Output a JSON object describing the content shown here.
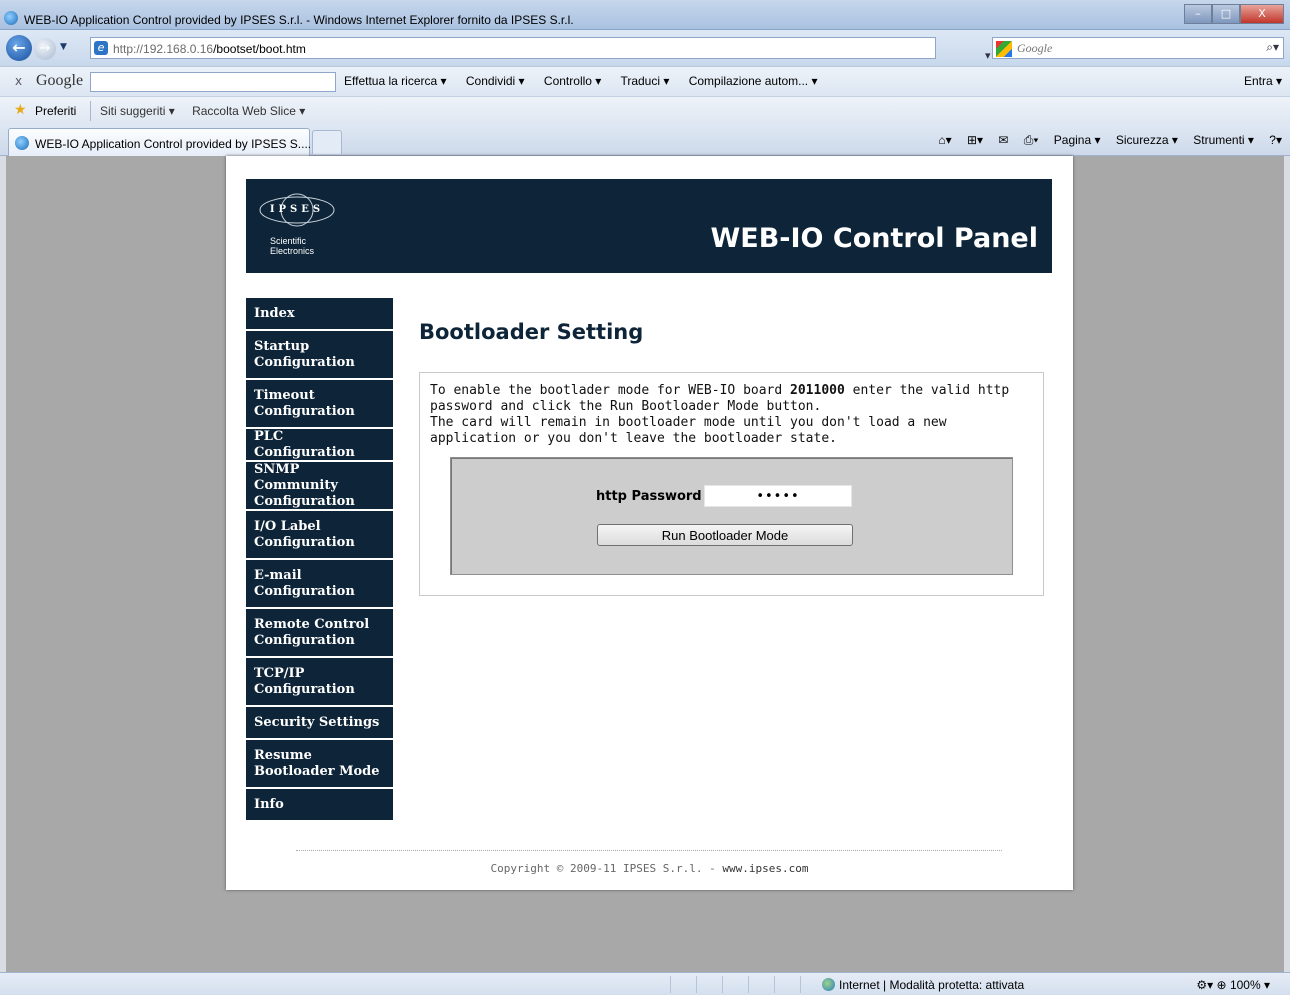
{
  "window": {
    "title": "WEB-IO Application Control provided by IPSES S.r.l. - Windows Internet Explorer fornito da IPSES S.r.l.",
    "buttons": {
      "minimize": "–",
      "maximize": "□",
      "close": "X"
    }
  },
  "address_bar": {
    "url_host": "http://192.168.0.16",
    "url_path": "/bootset/boot.htm",
    "search_placeholder": "Google"
  },
  "google_toolbar": {
    "logo": "Google",
    "items": [
      "Effettua la ricerca ▾",
      "Condividi ▾",
      "Controllo ▾",
      "Traduci ▾",
      "Compilazione autom... ▾"
    ],
    "right_label": "Entra ▾"
  },
  "favorites_bar": {
    "preferiti": "Preferiti",
    "links": [
      "Siti suggeriti ▾",
      "Raccolta Web Slice ▾"
    ]
  },
  "tabs": [
    {
      "label": "WEB-IO Application Control provided by IPSES S...."
    }
  ],
  "command_bar": {
    "items": [
      "Pagina ▾",
      "Sicurezza ▾",
      "Strumenti ▾"
    ]
  },
  "page": {
    "logo": {
      "brand": "IPSES",
      "tagline_line1": "Scientific",
      "tagline_line2": "Electronics"
    },
    "header_title": "WEB-IO Control Panel",
    "nav": [
      {
        "label": "Index",
        "lines": 1
      },
      {
        "label": "Startup Configuration",
        "lines": 2
      },
      {
        "label": "Timeout Configuration",
        "lines": 2
      },
      {
        "label": "PLC Configuration",
        "lines": 1
      },
      {
        "label": "SNMP Community Configuration",
        "lines": 2
      },
      {
        "label": "I/O Label Configuration",
        "lines": 2
      },
      {
        "label": "E-mail Configuration",
        "lines": 2
      },
      {
        "label": "Remote Control Configuration",
        "lines": 2
      },
      {
        "label": "TCP/IP Configuration",
        "lines": 2
      },
      {
        "label": "Security Settings",
        "lines": 1
      },
      {
        "label": "Resume Bootloader Mode",
        "lines": 2
      },
      {
        "label": "Info",
        "lines": 1
      }
    ],
    "section_title": "Bootloader Setting",
    "description": {
      "part1": "To enable the bootlader mode for WEB-IO board ",
      "board_id": "2011000",
      "part2": " enter the valid http password and click the Run Bootloader Mode button.",
      "line2": "The card will remain in bootloader mode until you don't load a new application or you don't leave the bootloader state."
    },
    "form": {
      "password_label": "http Password",
      "password_value": "•••••",
      "submit_label": "Run Bootloader Mode"
    },
    "footer": {
      "copyright": "Copyright © 2009-11 IPSES S.r.l. - ",
      "link": "www.ipses.com"
    }
  },
  "status_bar": {
    "zone": "Internet | Modalità protetta: attivata",
    "zoom": "100%"
  }
}
